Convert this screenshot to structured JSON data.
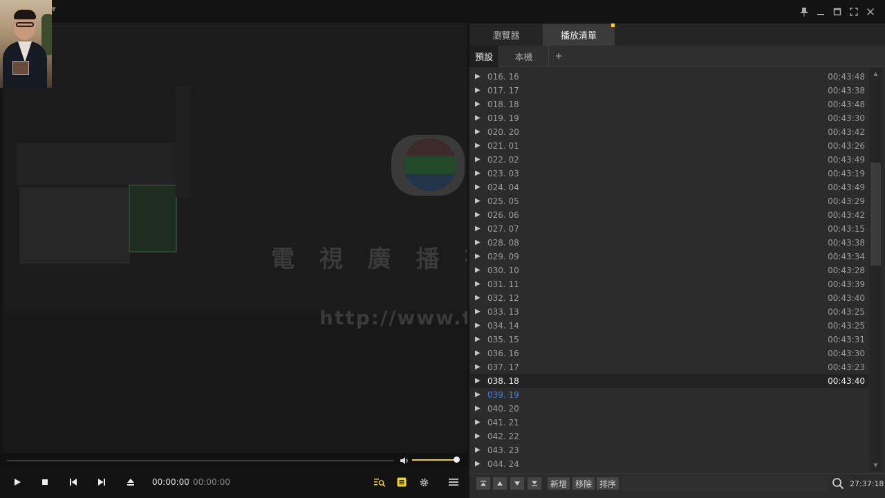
{
  "titlebar": {
    "icons": [
      "pin-icon",
      "minimize-icon",
      "maximize-icon",
      "fullscreen-icon",
      "close-icon"
    ]
  },
  "panel": {
    "tabs": [
      {
        "label": "瀏覽器",
        "active": false
      },
      {
        "label": "播放清單",
        "active": true
      }
    ],
    "subtabs": [
      {
        "label": "預設",
        "active": true
      },
      {
        "label": "本機",
        "active": false
      },
      {
        "label": "+",
        "active": false
      }
    ]
  },
  "playlist": {
    "items": [
      {
        "title": "016. 16",
        "duration": "00:43:48",
        "state": "normal"
      },
      {
        "title": "017. 17",
        "duration": "00:43:38",
        "state": "normal"
      },
      {
        "title": "018. 18",
        "duration": "00:43:48",
        "state": "normal"
      },
      {
        "title": "019. 19",
        "duration": "00:43:30",
        "state": "normal"
      },
      {
        "title": "020. 20",
        "duration": "00:43:42",
        "state": "normal"
      },
      {
        "title": "021. 01",
        "duration": "00:43:26",
        "state": "normal"
      },
      {
        "title": "022. 02",
        "duration": "00:43:49",
        "state": "normal"
      },
      {
        "title": "023. 03",
        "duration": "00:43:19",
        "state": "normal"
      },
      {
        "title": "024. 04",
        "duration": "00:43:49",
        "state": "normal"
      },
      {
        "title": "025. 05",
        "duration": "00:43:29",
        "state": "normal"
      },
      {
        "title": "026. 06",
        "duration": "00:43:42",
        "state": "normal"
      },
      {
        "title": "027. 07",
        "duration": "00:43:15",
        "state": "normal"
      },
      {
        "title": "028. 08",
        "duration": "00:43:38",
        "state": "normal"
      },
      {
        "title": "029. 09",
        "duration": "00:43:34",
        "state": "normal"
      },
      {
        "title": "030. 10",
        "duration": "00:43:28",
        "state": "normal"
      },
      {
        "title": "031. 11",
        "duration": "00:43:39",
        "state": "normal"
      },
      {
        "title": "032. 12",
        "duration": "00:43:40",
        "state": "normal"
      },
      {
        "title": "033. 13",
        "duration": "00:43:25",
        "state": "normal"
      },
      {
        "title": "034. 14",
        "duration": "00:43:25",
        "state": "normal"
      },
      {
        "title": "035. 15",
        "duration": "00:43:31",
        "state": "normal"
      },
      {
        "title": "036. 16",
        "duration": "00:43:30",
        "state": "normal"
      },
      {
        "title": "037. 17",
        "duration": "00:43:23",
        "state": "normal"
      },
      {
        "title": "038. 18",
        "duration": "00:43:40",
        "state": "current"
      },
      {
        "title": "039. 19",
        "duration": "",
        "state": "next"
      },
      {
        "title": "040. 20",
        "duration": "",
        "state": "normal"
      },
      {
        "title": "041. 21",
        "duration": "",
        "state": "normal"
      },
      {
        "title": "042. 22",
        "duration": "",
        "state": "normal"
      },
      {
        "title": "043. 23",
        "duration": "",
        "state": "normal"
      },
      {
        "title": "044. 24",
        "duration": "",
        "state": "normal"
      }
    ],
    "scroll_position": 0.22,
    "visible_fraction": 0.27
  },
  "footer": {
    "nav_icons": [
      "move-top-icon",
      "move-up-icon",
      "move-down-icon",
      "move-bottom-icon"
    ],
    "add_label": "新增",
    "remove_label": "移除",
    "sort_label": "排序",
    "search_placeholder": "",
    "total_duration": "27:37:18"
  },
  "player": {
    "current_time": "00:00:00",
    "separator": "/",
    "total_time": "00:00:00",
    "progress": 0.0,
    "volume": 1.0,
    "video_overlay_text": "電 視 廣 播 有",
    "video_overlay_url": "http://www.t"
  },
  "colors": {
    "accent": "#f0d21f",
    "next_item": "#3f84d6",
    "panel_bg": "#2c2c2c",
    "current_row_bg": "#232323"
  }
}
